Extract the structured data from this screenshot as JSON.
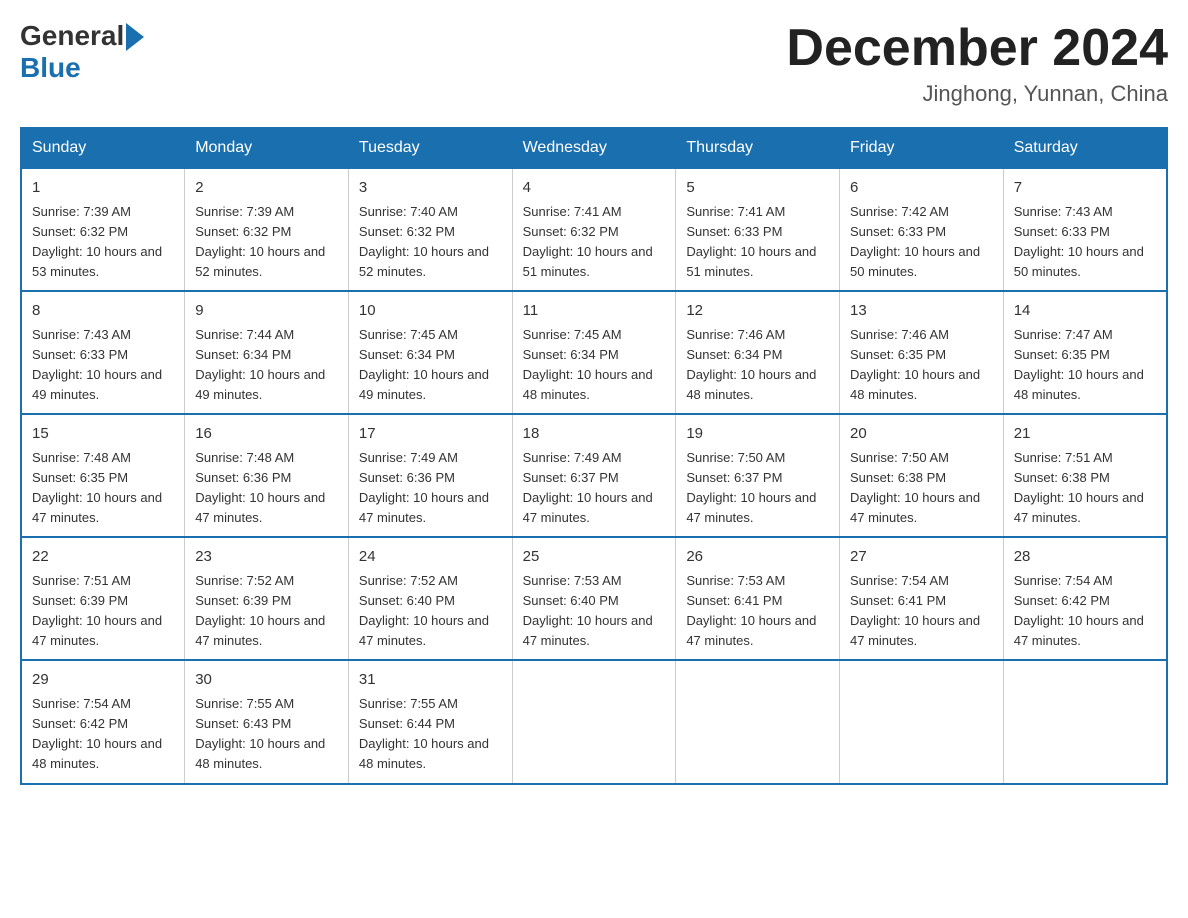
{
  "logo": {
    "general": "General",
    "blue": "Blue"
  },
  "title": {
    "month_year": "December 2024",
    "location": "Jinghong, Yunnan, China"
  },
  "headers": [
    "Sunday",
    "Monday",
    "Tuesday",
    "Wednesday",
    "Thursday",
    "Friday",
    "Saturday"
  ],
  "weeks": [
    [
      {
        "day": "1",
        "sunrise": "7:39 AM",
        "sunset": "6:32 PM",
        "daylight": "10 hours and 53 minutes."
      },
      {
        "day": "2",
        "sunrise": "7:39 AM",
        "sunset": "6:32 PM",
        "daylight": "10 hours and 52 minutes."
      },
      {
        "day": "3",
        "sunrise": "7:40 AM",
        "sunset": "6:32 PM",
        "daylight": "10 hours and 52 minutes."
      },
      {
        "day": "4",
        "sunrise": "7:41 AM",
        "sunset": "6:32 PM",
        "daylight": "10 hours and 51 minutes."
      },
      {
        "day": "5",
        "sunrise": "7:41 AM",
        "sunset": "6:33 PM",
        "daylight": "10 hours and 51 minutes."
      },
      {
        "day": "6",
        "sunrise": "7:42 AM",
        "sunset": "6:33 PM",
        "daylight": "10 hours and 50 minutes."
      },
      {
        "day": "7",
        "sunrise": "7:43 AM",
        "sunset": "6:33 PM",
        "daylight": "10 hours and 50 minutes."
      }
    ],
    [
      {
        "day": "8",
        "sunrise": "7:43 AM",
        "sunset": "6:33 PM",
        "daylight": "10 hours and 49 minutes."
      },
      {
        "day": "9",
        "sunrise": "7:44 AM",
        "sunset": "6:34 PM",
        "daylight": "10 hours and 49 minutes."
      },
      {
        "day": "10",
        "sunrise": "7:45 AM",
        "sunset": "6:34 PM",
        "daylight": "10 hours and 49 minutes."
      },
      {
        "day": "11",
        "sunrise": "7:45 AM",
        "sunset": "6:34 PM",
        "daylight": "10 hours and 48 minutes."
      },
      {
        "day": "12",
        "sunrise": "7:46 AM",
        "sunset": "6:34 PM",
        "daylight": "10 hours and 48 minutes."
      },
      {
        "day": "13",
        "sunrise": "7:46 AM",
        "sunset": "6:35 PM",
        "daylight": "10 hours and 48 minutes."
      },
      {
        "day": "14",
        "sunrise": "7:47 AM",
        "sunset": "6:35 PM",
        "daylight": "10 hours and 48 minutes."
      }
    ],
    [
      {
        "day": "15",
        "sunrise": "7:48 AM",
        "sunset": "6:35 PM",
        "daylight": "10 hours and 47 minutes."
      },
      {
        "day": "16",
        "sunrise": "7:48 AM",
        "sunset": "6:36 PM",
        "daylight": "10 hours and 47 minutes."
      },
      {
        "day": "17",
        "sunrise": "7:49 AM",
        "sunset": "6:36 PM",
        "daylight": "10 hours and 47 minutes."
      },
      {
        "day": "18",
        "sunrise": "7:49 AM",
        "sunset": "6:37 PM",
        "daylight": "10 hours and 47 minutes."
      },
      {
        "day": "19",
        "sunrise": "7:50 AM",
        "sunset": "6:37 PM",
        "daylight": "10 hours and 47 minutes."
      },
      {
        "day": "20",
        "sunrise": "7:50 AM",
        "sunset": "6:38 PM",
        "daylight": "10 hours and 47 minutes."
      },
      {
        "day": "21",
        "sunrise": "7:51 AM",
        "sunset": "6:38 PM",
        "daylight": "10 hours and 47 minutes."
      }
    ],
    [
      {
        "day": "22",
        "sunrise": "7:51 AM",
        "sunset": "6:39 PM",
        "daylight": "10 hours and 47 minutes."
      },
      {
        "day": "23",
        "sunrise": "7:52 AM",
        "sunset": "6:39 PM",
        "daylight": "10 hours and 47 minutes."
      },
      {
        "day": "24",
        "sunrise": "7:52 AM",
        "sunset": "6:40 PM",
        "daylight": "10 hours and 47 minutes."
      },
      {
        "day": "25",
        "sunrise": "7:53 AM",
        "sunset": "6:40 PM",
        "daylight": "10 hours and 47 minutes."
      },
      {
        "day": "26",
        "sunrise": "7:53 AM",
        "sunset": "6:41 PM",
        "daylight": "10 hours and 47 minutes."
      },
      {
        "day": "27",
        "sunrise": "7:54 AM",
        "sunset": "6:41 PM",
        "daylight": "10 hours and 47 minutes."
      },
      {
        "day": "28",
        "sunrise": "7:54 AM",
        "sunset": "6:42 PM",
        "daylight": "10 hours and 47 minutes."
      }
    ],
    [
      {
        "day": "29",
        "sunrise": "7:54 AM",
        "sunset": "6:42 PM",
        "daylight": "10 hours and 48 minutes."
      },
      {
        "day": "30",
        "sunrise": "7:55 AM",
        "sunset": "6:43 PM",
        "daylight": "10 hours and 48 minutes."
      },
      {
        "day": "31",
        "sunrise": "7:55 AM",
        "sunset": "6:44 PM",
        "daylight": "10 hours and 48 minutes."
      },
      null,
      null,
      null,
      null
    ]
  ]
}
